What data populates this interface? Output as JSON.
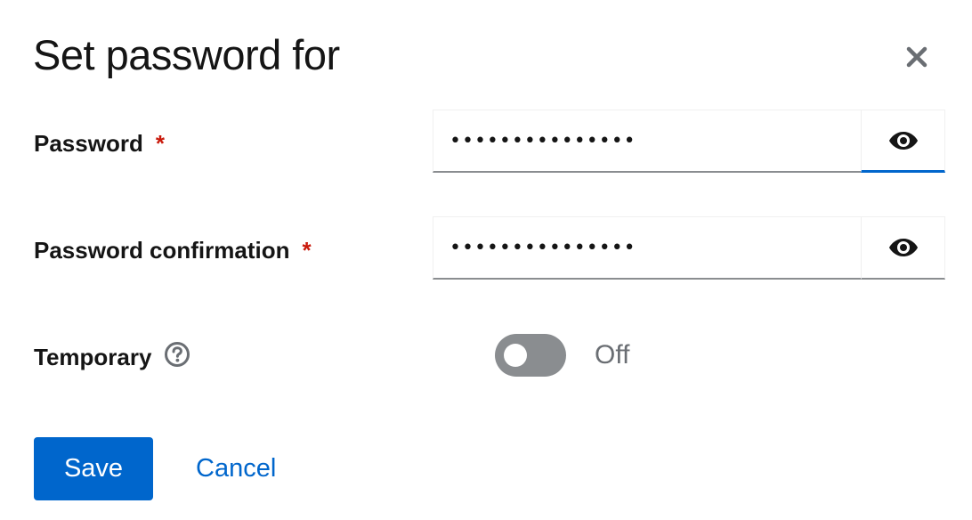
{
  "modal": {
    "title": "Set password for",
    "close_icon": "close-icon"
  },
  "form": {
    "password": {
      "label": "Password",
      "required_marker": "*",
      "value": "•••••••••••••••",
      "toggle_icon": "eye-icon"
    },
    "password_confirmation": {
      "label": "Password confirmation",
      "required_marker": "*",
      "value": "•••••••••••••••",
      "toggle_icon": "eye-icon"
    },
    "temporary": {
      "label": "Temporary",
      "help_icon": "question-circle-icon",
      "state_label": "Off",
      "checked": false
    }
  },
  "actions": {
    "save_label": "Save",
    "cancel_label": "Cancel"
  },
  "colors": {
    "primary": "#0066cc",
    "required": "#c9190b",
    "switch_off": "#8a8d90",
    "muted_text": "#6a6e73"
  }
}
